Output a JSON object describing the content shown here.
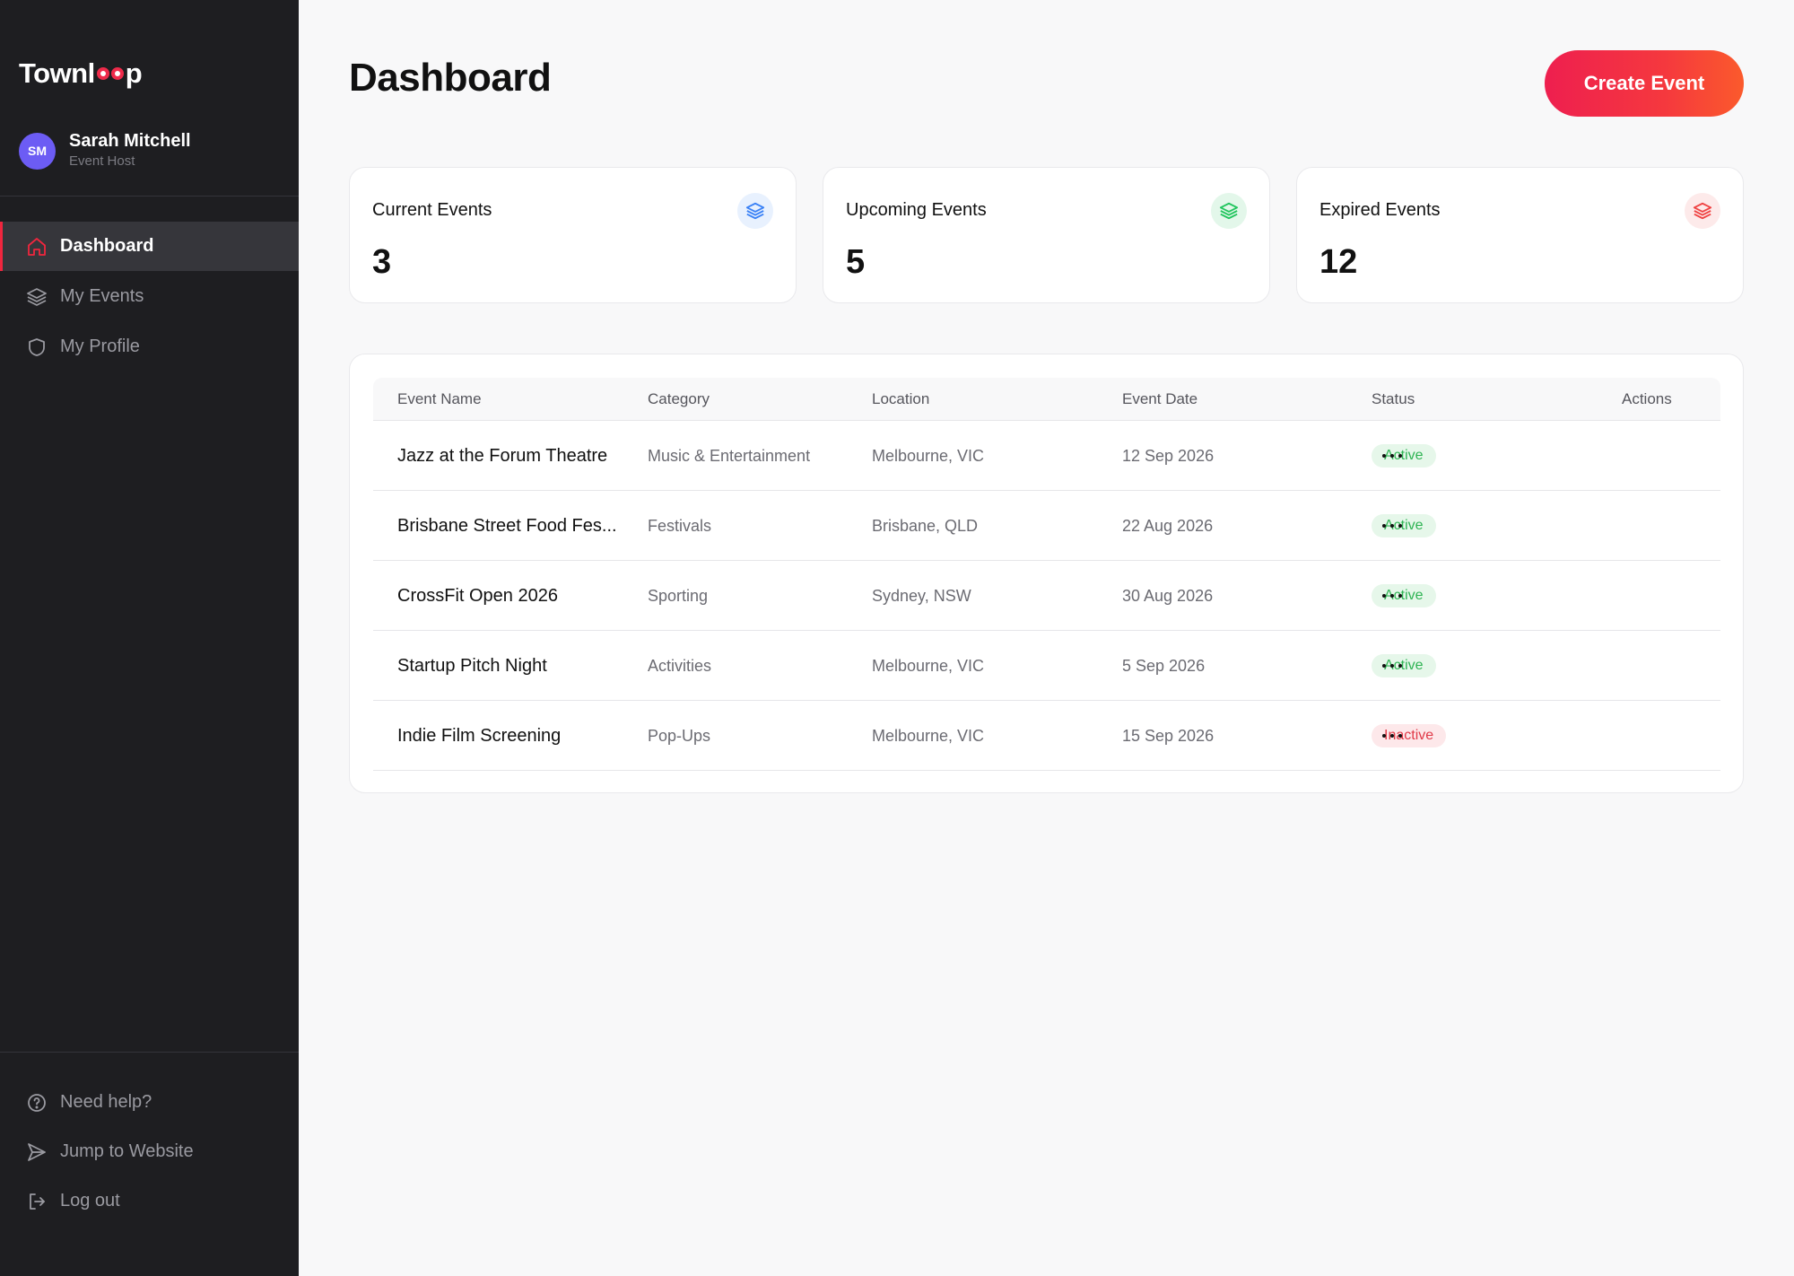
{
  "app": {
    "logo_prefix": "Townl",
    "logo_suffix": "p"
  },
  "user": {
    "initials": "SM",
    "name": "Sarah Mitchell",
    "role": "Event Host",
    "avatar_color": "#6c5cf4"
  },
  "nav": {
    "items": [
      {
        "label": "Dashboard",
        "icon": "home-icon",
        "active": true
      },
      {
        "label": "My Events",
        "icon": "layers-icon",
        "active": false
      },
      {
        "label": "My Profile",
        "icon": "shield-icon",
        "active": false
      }
    ],
    "footer": [
      {
        "label": "Need help?",
        "icon": "help-circle-icon"
      },
      {
        "label": "Jump to Website",
        "icon": "send-icon"
      },
      {
        "label": "Log out",
        "icon": "logout-icon"
      }
    ]
  },
  "header": {
    "title": "Dashboard",
    "create_label": "Create Event",
    "accent": "#f0263e"
  },
  "stats": [
    {
      "label": "Current Events",
      "value": "3",
      "icon": "layers-icon",
      "color": "#3b82f6",
      "bg": "#e8f1fe"
    },
    {
      "label": "Upcoming Events",
      "value": "5",
      "icon": "layers-icon",
      "color": "#22c55e",
      "bg": "#e3f7ea"
    },
    {
      "label": "Expired Events",
      "value": "12",
      "icon": "layers-icon",
      "color": "#ef4444",
      "bg": "#fdeaea"
    }
  ],
  "table": {
    "columns": [
      "Event Name",
      "Category",
      "Location",
      "Event Date",
      "Status",
      "Actions"
    ],
    "rows": [
      {
        "name": "Jazz at the Forum Theatre",
        "category": "Music & Entertainment",
        "location": "Melbourne, VIC",
        "date": "12 Sep 2026",
        "status": "Active"
      },
      {
        "name": "Brisbane Street Food Fes...",
        "category": "Festivals",
        "location": "Brisbane, QLD",
        "date": "22 Aug 2026",
        "status": "Active"
      },
      {
        "name": "CrossFit Open 2026",
        "category": "Sporting",
        "location": "Sydney, NSW",
        "date": "30 Aug 2026",
        "status": "Active"
      },
      {
        "name": "Startup Pitch Night",
        "category": "Activities",
        "location": "Melbourne, VIC",
        "date": "5 Sep 2026",
        "status": "Active"
      },
      {
        "name": "Indie Film Screening",
        "category": "Pop-Ups",
        "location": "Melbourne, VIC",
        "date": "15 Sep 2026",
        "status": "Inactive"
      }
    ]
  }
}
